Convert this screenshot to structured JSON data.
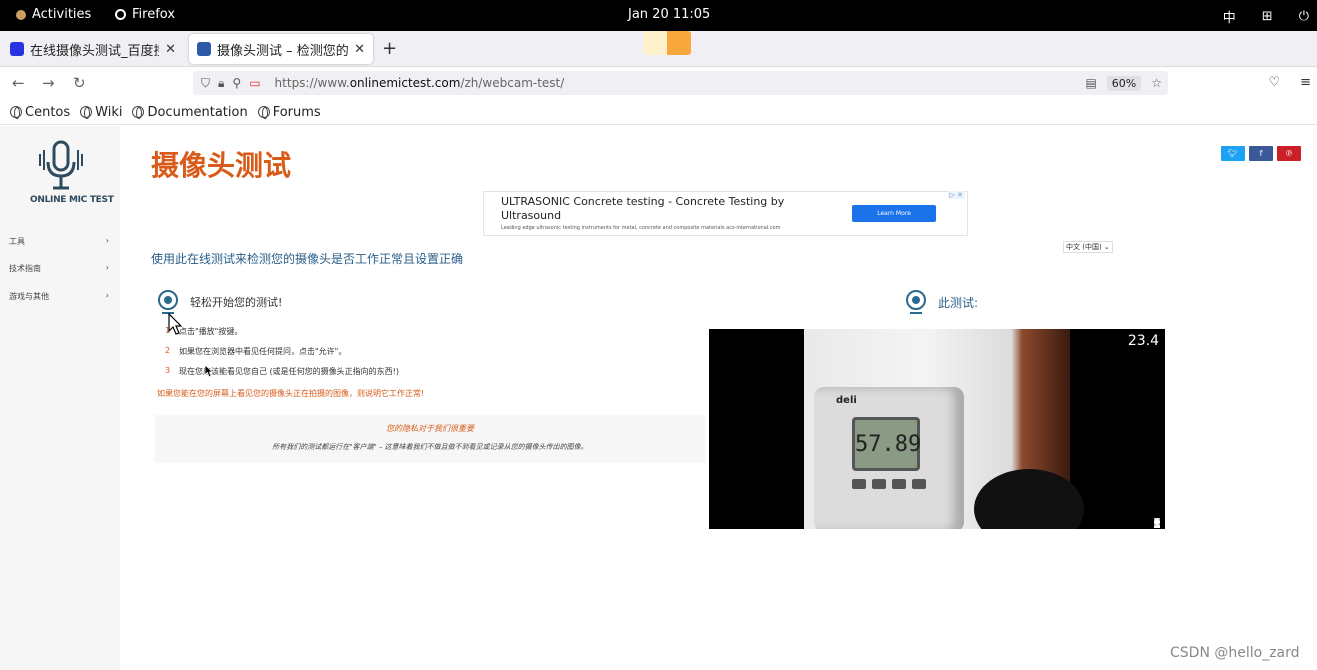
{
  "system_bar": {
    "activities": "Activities",
    "app_name": "Firefox",
    "datetime": "Jan 20  11:05",
    "input_method": "中"
  },
  "tabs": [
    {
      "title": "在线摄像头测试_百度搜索",
      "active": false
    },
    {
      "title": "摄像头测试 – 检测您的电脑",
      "active": true
    }
  ],
  "url_bar": {
    "url_prefix": "https://www.",
    "url_domain": "onlinemictest.com",
    "url_path": "/zh/webcam-test/",
    "zoom": "60%"
  },
  "bookmarks": [
    "Centos",
    "Wiki",
    "Documentation",
    "Forums"
  ],
  "sidebar": {
    "logo_text": "ONLINE MIC TEST",
    "items": [
      {
        "label": "工具"
      },
      {
        "label": "技术指南"
      },
      {
        "label": "游戏与其他"
      }
    ]
  },
  "page": {
    "title": "摄像头测试",
    "subtitle": "使用此在线测试来检测您的摄像头是否工作正常且设置正确",
    "language": "中文 (中国)",
    "share": [
      "twitter",
      "facebook",
      "pinterest"
    ]
  },
  "ad": {
    "title": "ULTRASONIC Concrete testing - Concrete Testing by Ultrasound",
    "subtitle": "Leading edge ultrasonic testing instruments for metal, concrete and composite materials acs-international.com",
    "button": "Learn More",
    "close": "▷ ✕"
  },
  "start": {
    "heading": "轻松开始您的测试!",
    "steps": [
      {
        "n": "1",
        "text": "点击\"播放\"按键。"
      },
      {
        "n": "2",
        "text": "如果您在浏览器中看见任何提问，点击\"允许\"。"
      },
      {
        "n": "3",
        "text": "现在您应该能看见您自己 (或是任何您的摄像头正指向的东西!)"
      }
    ],
    "ok_note": "如果您能在您的屏幕上看见您的摄像头正在拍摄的图像，则说明它工作正常!"
  },
  "privacy": {
    "heading": "您的隐私对于我们很重要",
    "text": "所有我们的测试都运行在\"客户端\" – 这意味着我们不做且做不到看见或记录从您的摄像头传出的图像。"
  },
  "test": {
    "heading": "此测试:",
    "fps": "23.4",
    "lcd": "57.89",
    "brand": "deli"
  },
  "watermark": "CSDN @hello_zard",
  "colors": {
    "accent_orange": "#d85b1a",
    "title_blue": "#2a5f8a",
    "twitter": "#1da1f2",
    "facebook": "#3b5998",
    "pinterest": "#cb2027"
  }
}
